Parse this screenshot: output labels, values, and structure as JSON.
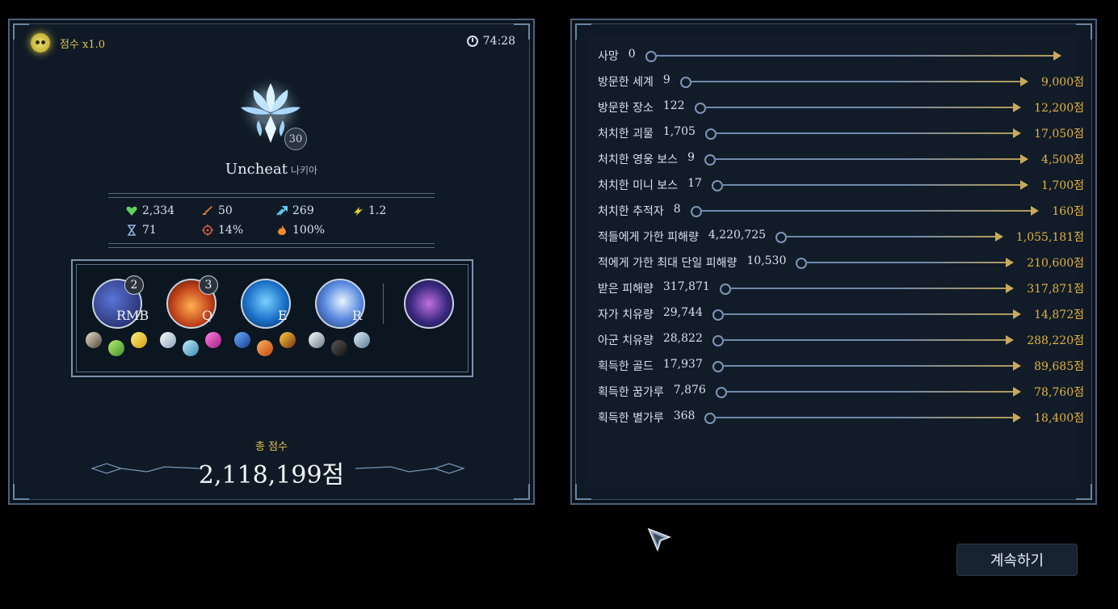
{
  "header": {
    "score_multiplier": "점수 x1.0",
    "timer": "74:28"
  },
  "player": {
    "name": "Uncheat",
    "subtitle": "나키아",
    "level": "30"
  },
  "stats": {
    "health": "2,334",
    "attack": "50",
    "speed": "269",
    "crit_mult": "1.2",
    "cooldown": "71",
    "crit_chance": "14%",
    "fire": "100%"
  },
  "skills": [
    {
      "key": "RMB",
      "count": "2"
    },
    {
      "key": "Q",
      "count": "3"
    },
    {
      "key": "E",
      "count": ""
    },
    {
      "key": "R",
      "count": ""
    }
  ],
  "total": {
    "label": "총 점수",
    "score": "2,118,199점"
  },
  "score_rows": [
    {
      "label": "사망",
      "value": "0",
      "points": ""
    },
    {
      "label": "방문한 세계",
      "value": "9",
      "points": "9,000점"
    },
    {
      "label": "방문한 장소",
      "value": "122",
      "points": "12,200점"
    },
    {
      "label": "처치한 괴물",
      "value": "1,705",
      "points": "17,050점"
    },
    {
      "label": "처치한 영웅 보스",
      "value": "9",
      "points": "4,500점"
    },
    {
      "label": "처치한 미니 보스",
      "value": "17",
      "points": "1,700점"
    },
    {
      "label": "처치한 추적자",
      "value": "8",
      "points": "160점"
    },
    {
      "label": "적들에게 가한 피해량",
      "value": "4,220,725",
      "points": "1,055,181점"
    },
    {
      "label": "적에게 가한 최대 단일 피해량",
      "value": "10,530",
      "points": "210,600점"
    },
    {
      "label": "받은 피해량",
      "value": "317,871",
      "points": "317,871점"
    },
    {
      "label": "자가 치유량",
      "value": "29,744",
      "points": "14,872점"
    },
    {
      "label": "아군 치유량",
      "value": "28,822",
      "points": "288,220점"
    },
    {
      "label": "획득한 골드",
      "value": "17,937",
      "points": "89,685점"
    },
    {
      "label": "획득한 꿈가루",
      "value": "7,876",
      "points": "78,760점"
    },
    {
      "label": "획득한 별가루",
      "value": "368",
      "points": "18,400점"
    }
  ],
  "continue_label": "계속하기"
}
